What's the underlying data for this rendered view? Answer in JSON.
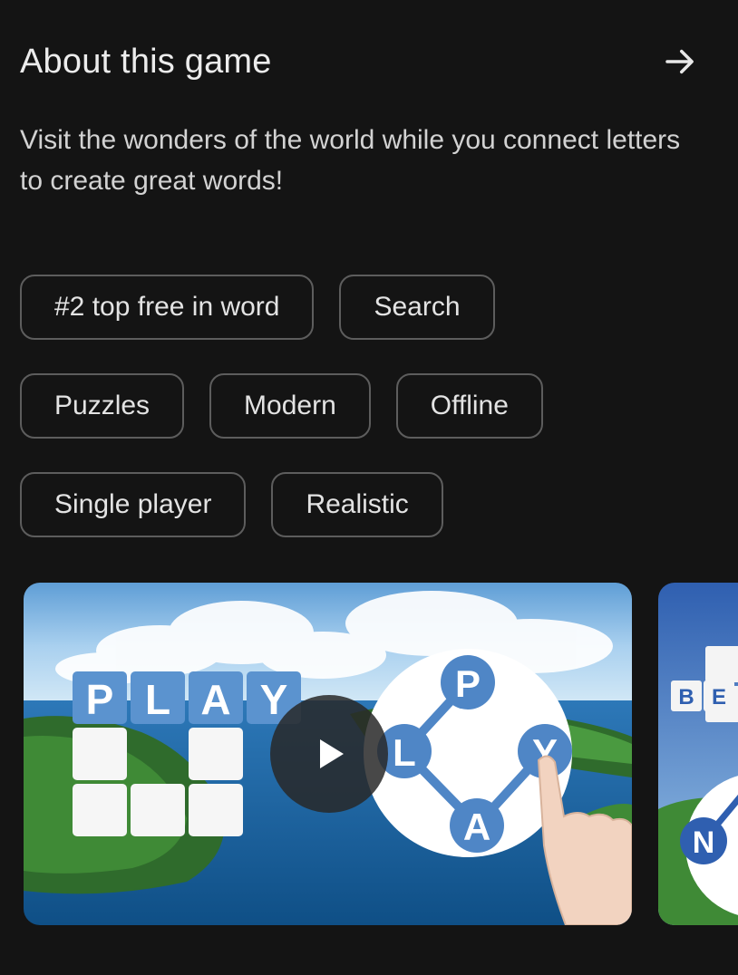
{
  "section": {
    "title": "About this game",
    "arrow_icon": "arrow-right-icon"
  },
  "description": "Visit the wonders of the world while you connect letters to create great words!",
  "tags": [
    [
      "#2 top free in word",
      "Search"
    ],
    [
      "Puzzles",
      "Modern",
      "Offline"
    ],
    [
      "Single player",
      "Realistic"
    ]
  ],
  "media": {
    "video_thumbnail": {
      "tile_word": [
        "P",
        "L",
        "A",
        "Y"
      ],
      "wheel_letters": [
        "P",
        "L",
        "Y",
        "A"
      ],
      "play_icon": "play-icon"
    },
    "screenshot": {
      "tile_letters": [
        "B",
        "E"
      ],
      "wheel_letter": "N"
    }
  },
  "colors": {
    "background": "#141414",
    "chip_border": "#5d5d5d",
    "tile_blue": "#5b93cf",
    "wheel_letter_blue": "#4f86c6"
  }
}
